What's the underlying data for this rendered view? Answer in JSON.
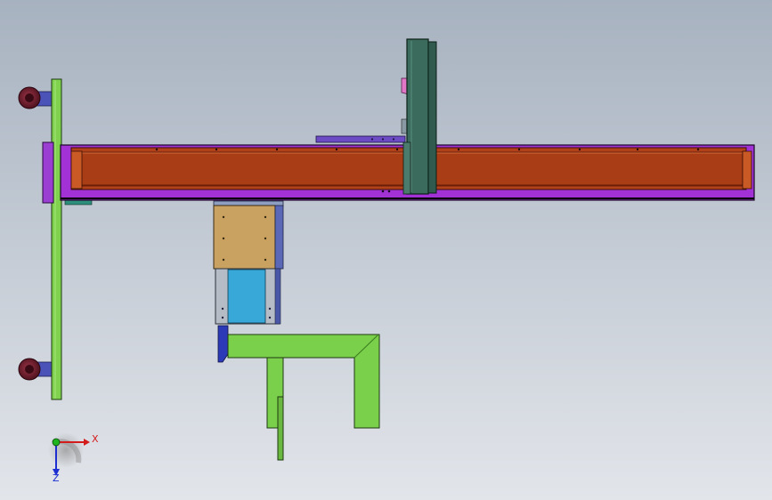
{
  "viewport": {
    "background_top": "#a7b2c0",
    "background_bottom": "#dfe3e8",
    "model": {
      "parts": [
        {
          "name": "frame-rail-beam",
          "color": "#b1411a"
        },
        {
          "name": "rail-base-plate",
          "color": "#a232d6"
        },
        {
          "name": "side-post",
          "color": "#7fd14e"
        },
        {
          "name": "gantry-column",
          "color": "#3a6b5c"
        },
        {
          "name": "carriage-upper-block",
          "color": "#c9a262"
        },
        {
          "name": "carriage-lower-block",
          "color": "#38a8d8"
        },
        {
          "name": "bracket-arm",
          "color": "#7ad04a"
        },
        {
          "name": "caster-wheel",
          "color": "#6e1a2a"
        }
      ]
    }
  },
  "triad": {
    "x_label": "X",
    "z_label": "Z",
    "x_color": "#d31c1c",
    "y_color": "#1fb31f",
    "z_color": "#1d2fd0"
  }
}
